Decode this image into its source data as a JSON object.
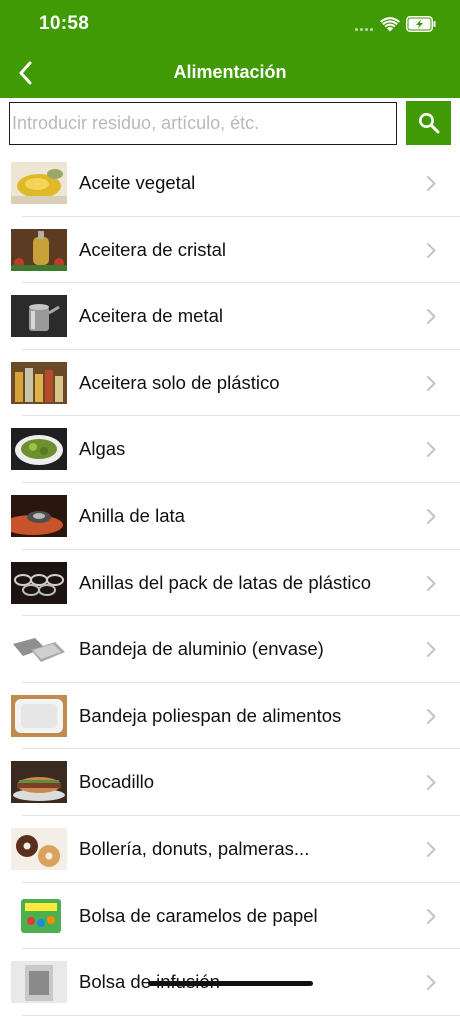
{
  "status_bar": {
    "time": "10:58"
  },
  "navbar": {
    "title": "Alimentación",
    "back_icon": "chevron-left-icon"
  },
  "search": {
    "placeholder": "Introducir residuo, artículo, étc.",
    "value": "",
    "icon": "search-icon"
  },
  "colors": {
    "brand_green": "#3f9a05",
    "separator": "#e3e3e3",
    "chevron": "#c4c4c4"
  },
  "items": [
    {
      "label": "Aceite vegetal",
      "thumbnail": "vegetable-oil-photo"
    },
    {
      "label": "Aceitera de cristal",
      "thumbnail": "glass-oil-cruet-photo"
    },
    {
      "label": "Aceitera de metal",
      "thumbnail": "metal-oil-can-photo"
    },
    {
      "label": "Aceitera solo de plástico",
      "thumbnail": "plastic-oil-bottles-photo"
    },
    {
      "label": "Algas",
      "thumbnail": "seaweed-bowl-photo"
    },
    {
      "label": "Anilla de lata",
      "thumbnail": "can-ring-photo"
    },
    {
      "label": "Anillas del pack de latas de plástico",
      "thumbnail": "plastic-six-pack-rings-photo"
    },
    {
      "label": "Bandeja de aluminio (envase)",
      "thumbnail": "aluminium-trays-photo"
    },
    {
      "label": "Bandeja poliespan de alimentos",
      "thumbnail": "polystyrene-tray-photo"
    },
    {
      "label": "Bocadillo",
      "thumbnail": "sandwich-photo"
    },
    {
      "label": "Bollería, donuts, palmeras...",
      "thumbnail": "pastries-photo"
    },
    {
      "label": "Bolsa de caramelos de papel",
      "thumbnail": "candy-bag-photo"
    },
    {
      "label": "Bolsa de infusión",
      "thumbnail": "tea-bag-photo"
    }
  ]
}
